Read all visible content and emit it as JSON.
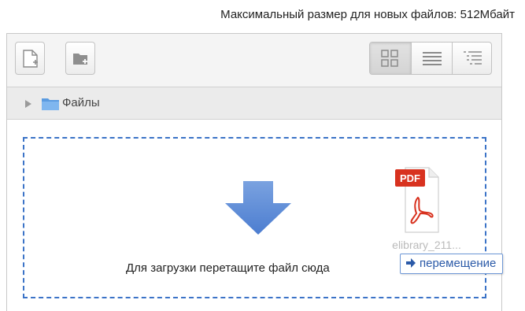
{
  "header": {
    "max_size_text": "Максимальный размер для новых файлов: 512Мбайт"
  },
  "toolbar": {
    "add_file_icon": "add-file-icon",
    "create_folder_icon": "create-folder-icon",
    "view_modes": [
      {
        "name": "icons-view",
        "icon": "grid-icon",
        "active": true
      },
      {
        "name": "list-view",
        "icon": "list-icon",
        "active": false
      },
      {
        "name": "tree-view",
        "icon": "tree-list-icon",
        "active": false
      }
    ]
  },
  "path": {
    "folder_label": "Файлы"
  },
  "dropzone": {
    "instruction": "Для загрузки перетащите файл сюда",
    "dragged_file": {
      "type_label": "PDF",
      "name": "elibrary_211..."
    },
    "drag_tooltip": "перемещение"
  },
  "colors": {
    "accent": "#3b73c7",
    "pdf_red": "#d8321f"
  }
}
